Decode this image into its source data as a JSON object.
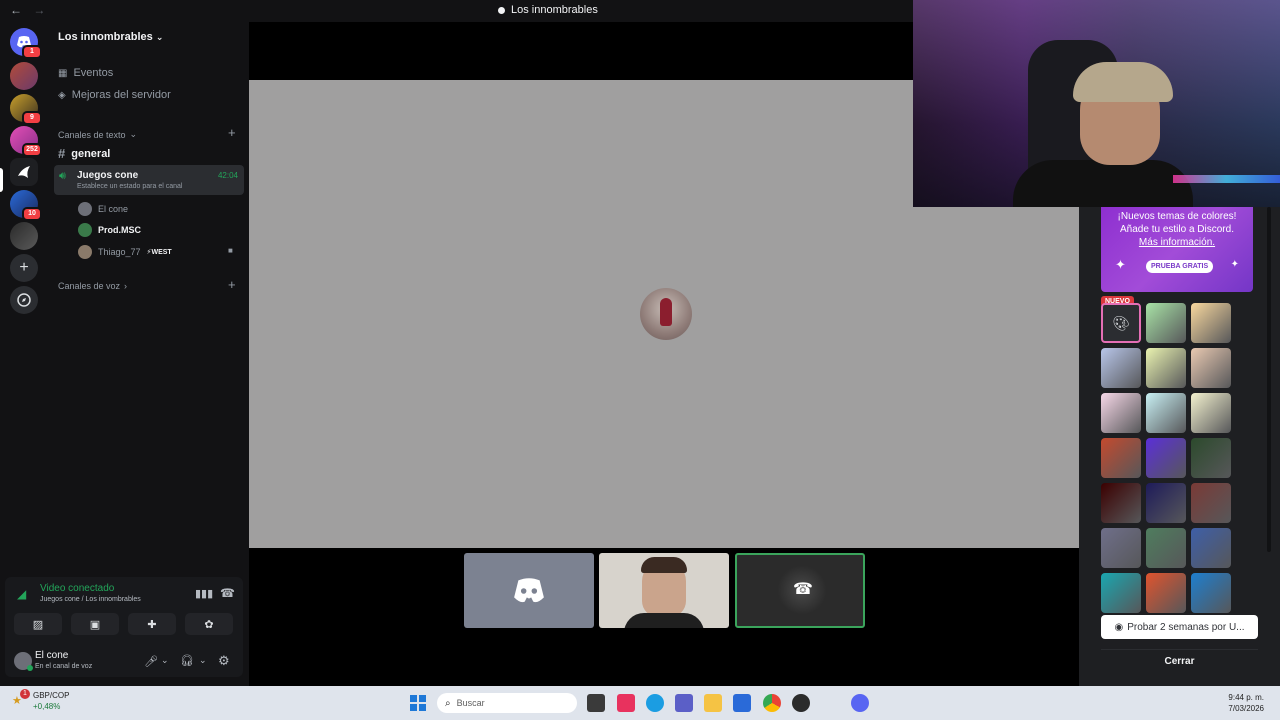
{
  "window": {
    "title": "Los innombrables",
    "back": "←",
    "forward": "→"
  },
  "rail": {
    "home_badge": "1",
    "servers": [
      {
        "badge": ""
      },
      {
        "badge": "9"
      },
      {
        "badge": "252"
      },
      {
        "badge": ""
      },
      {
        "badge": "10"
      },
      {
        "badge": ""
      }
    ]
  },
  "sidebar": {
    "server_name": "Los innombrables",
    "events": "Eventos",
    "boosts": "Mejoras del servidor",
    "text_category": "Canales de texto",
    "general": "general",
    "voice_channel": {
      "name": "Juegos cone",
      "status": "Establece un estado para el canal",
      "time": "42:04"
    },
    "voice_users": [
      {
        "name": "El cone"
      },
      {
        "name": "Prod.MSC"
      },
      {
        "name": "Thiago_77",
        "tag": "⚡WEST"
      }
    ],
    "voice_category": "Canales de voz"
  },
  "voice_panel": {
    "title": "Video conectado",
    "subtitle": "Juegos cone / Los innombrables"
  },
  "user": {
    "name": "El cone",
    "status": "En el canal de voz"
  },
  "right_panel": {
    "promo_line1": "¡Nuevos temas de colores!",
    "promo_line2": "Añade tu estilo a Discord.",
    "promo_link": "Más información.",
    "promo_button": "PRUEBA GRATIS",
    "new_badge": "NUEVO",
    "trial_button": "Probar 2 semanas por U...",
    "close_button": "Cerrar",
    "swatches": [
      {
        "color": "#2b2d31"
      },
      {
        "color": "#a8e3a6"
      },
      {
        "color": "#f9d89e"
      },
      {
        "color": "#b8c6ea"
      },
      {
        "color": "#eaf3b0"
      },
      {
        "color": "#e9c9b1"
      },
      {
        "color": "#f7d8e8"
      },
      {
        "color": "#c8f0f4"
      },
      {
        "color": "#f4f2cf"
      },
      {
        "color": "#c44a2e"
      },
      {
        "color": "#5b2fd8"
      },
      {
        "color": "#2c4a2c"
      },
      {
        "color": "#3b0000"
      },
      {
        "color": "#1e1b5a"
      },
      {
        "color": "#7a3a36"
      },
      {
        "color": "#6f6f8a"
      },
      {
        "color": "#4f7d5e"
      },
      {
        "color": "#3e5fa8"
      },
      {
        "color": "#1aa7b0"
      },
      {
        "color": "#e0542e"
      },
      {
        "color": "#1e7fcf"
      }
    ]
  },
  "taskbar": {
    "ticker": "GBP/COP",
    "change": "+0,48%",
    "alert_badge": "1",
    "search": "Buscar",
    "time": "9:44 p. m.",
    "date": "7/03/2026"
  }
}
